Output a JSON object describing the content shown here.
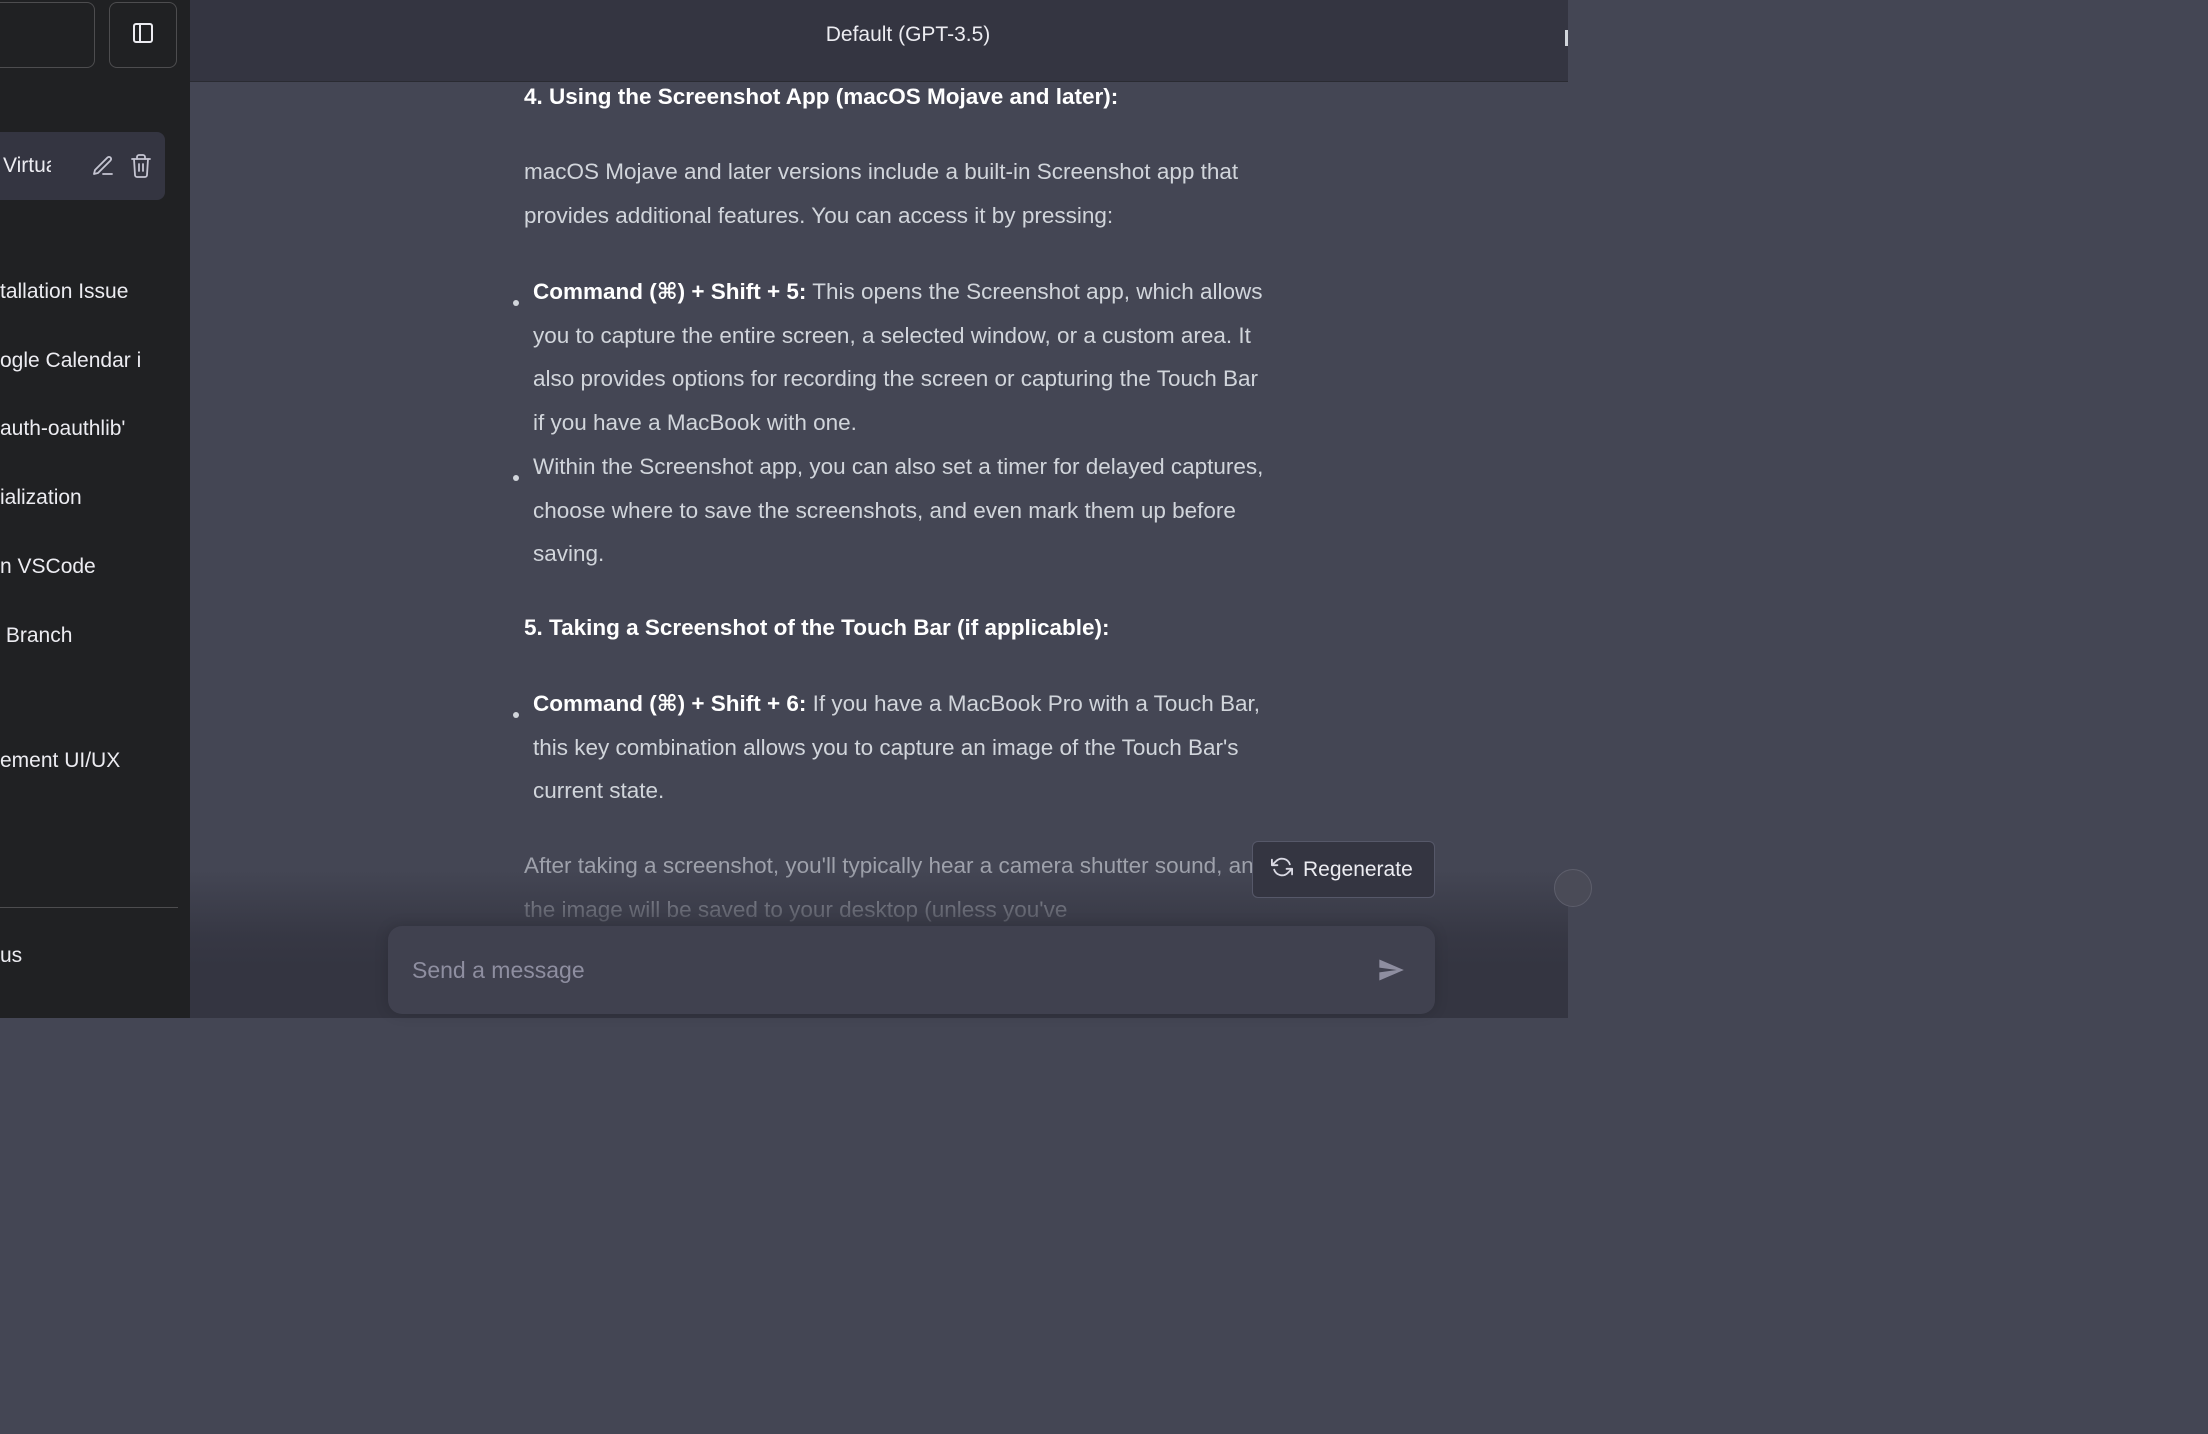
{
  "sidebar": {
    "active_item": "Virtual",
    "items": [
      "tallation Issue",
      "ogle Calendar i",
      "auth-oauthlib'",
      "ialization",
      "n VSCode",
      " Branch",
      "ement UI/UX"
    ],
    "bottom_item": "us"
  },
  "header": {
    "model_title": "Default (GPT-3.5)"
  },
  "message": {
    "section4_heading": "4. Using the Screenshot App (macOS Mojave and later):",
    "section4_intro": "macOS Mojave and later versions include a built-in Screenshot app that provides additional features. You can access it by pressing:",
    "section4_bullet1_bold": "Command (⌘) + Shift + 5:",
    "section4_bullet1_text": " This opens the Screenshot app, which allows you to capture the entire screen, a selected window, or a custom area. It also provides options for recording the screen or capturing the Touch Bar if you have a MacBook with one.",
    "section4_bullet2_text": "Within the Screenshot app, you can also set a timer for delayed captures, choose where to save the screenshots, and even mark them up before saving.",
    "section5_heading": "5. Taking a Screenshot of the Touch Bar (if applicable):",
    "section5_bullet1_bold": "Command (⌘) + Shift + 6:",
    "section5_bullet1_text": " If you have a MacBook Pro with a Touch Bar, this key combination allows you to capture an image of the Touch Bar's current state.",
    "closing_text": "After taking a screenshot, you'll typically hear a camera shutter sound, and the image will be saved to your desktop (unless you've"
  },
  "controls": {
    "regenerate_label": "Regenerate",
    "input_placeholder": "Send a message"
  },
  "icons": {
    "sidebar_toggle": "sidebar-toggle-icon",
    "edit": "pencil-icon",
    "delete": "trash-icon",
    "regenerate": "refresh-icon",
    "send": "send-icon"
  },
  "colors": {
    "sidebar_bg": "#202123",
    "main_bg": "#444654",
    "header_bg": "#343541",
    "input_bg": "#40414f"
  }
}
